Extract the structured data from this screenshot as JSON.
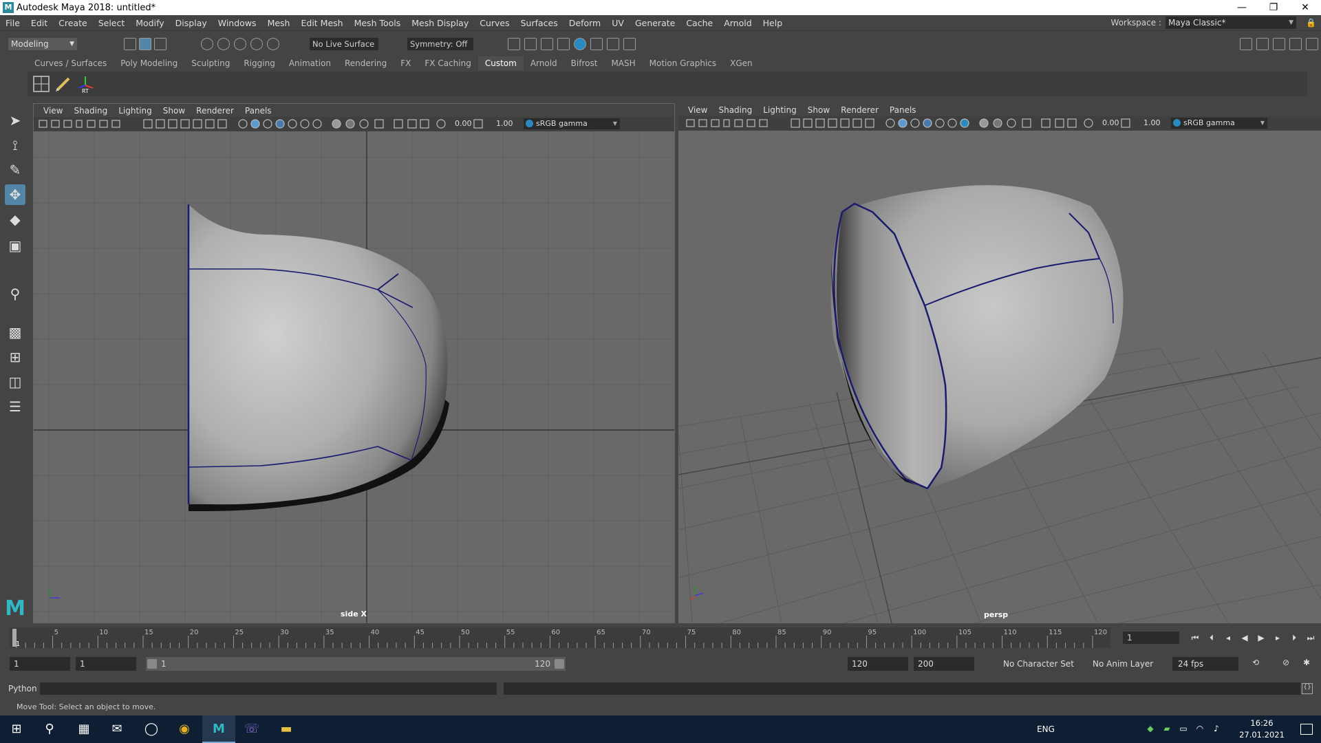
{
  "window": {
    "app_icon": "M",
    "title": "Autodesk Maya 2018: untitled*",
    "minimize": "—",
    "restore": "❐",
    "close": "✕"
  },
  "menus": [
    "File",
    "Edit",
    "Create",
    "Select",
    "Modify",
    "Display",
    "Windows",
    "Mesh",
    "Edit Mesh",
    "Mesh Tools",
    "Mesh Display",
    "Curves",
    "Surfaces",
    "Deform",
    "UV",
    "Generate",
    "Cache",
    "Arnold",
    "Help"
  ],
  "workspace": {
    "label": "Workspace :",
    "value": "Maya Classic*"
  },
  "status_line": {
    "mode": "Modeling",
    "live_surface": "No Live Surface",
    "symmetry": "Symmetry: Off"
  },
  "shelf": {
    "tabs": [
      "Curves / Surfaces",
      "Poly Modeling",
      "Sculpting",
      "Rigging",
      "Animation",
      "Rendering",
      "FX",
      "FX Caching",
      "Custom",
      "Arnold",
      "Bifrost",
      "MASH",
      "Motion Graphics",
      "XGen"
    ],
    "active_tab": "Custom",
    "rt_label": "RT"
  },
  "viewport_menu": [
    "View",
    "Shading",
    "Lighting",
    "Show",
    "Renderer",
    "Panels"
  ],
  "viewports": {
    "left": {
      "camera_label": "side X",
      "exposure": "0.00",
      "gamma_value": "1.00",
      "colorspace": "sRGB gamma"
    },
    "right": {
      "camera_label": "persp",
      "exposure": "0.00",
      "gamma_value": "1.00",
      "colorspace": "sRGB gamma"
    }
  },
  "timeline": {
    "ticks": [
      5,
      10,
      15,
      20,
      25,
      30,
      35,
      40,
      45,
      50,
      55,
      60,
      65,
      70,
      75,
      80,
      85,
      90,
      95,
      100,
      105,
      110,
      115,
      120
    ],
    "start_tick": "1",
    "range_max": 120,
    "current_frame": "1"
  },
  "range": {
    "start": "1",
    "playback_start": "1",
    "bar_start": "1",
    "bar_end": "120",
    "playback_end": "120",
    "end": "200",
    "character_set": "No Character Set",
    "anim_layer": "No Anim Layer",
    "fps": "24 fps"
  },
  "command_line": {
    "language": "Python"
  },
  "help_line": "Move Tool: Select an object to move.",
  "taskbar": {
    "language": "ENG",
    "time": "16:26",
    "date": "27.01.2021"
  }
}
